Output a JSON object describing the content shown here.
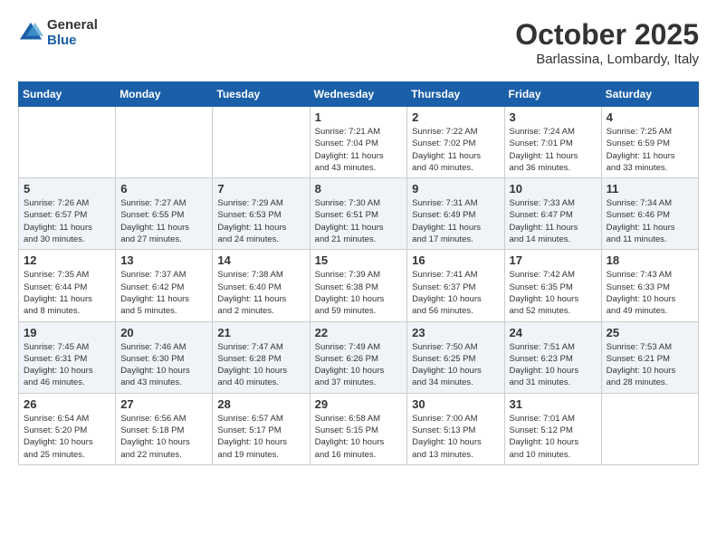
{
  "header": {
    "logo_general": "General",
    "logo_blue": "Blue",
    "month_title": "October 2025",
    "location": "Barlassina, Lombardy, Italy"
  },
  "calendar": {
    "days_of_week": [
      "Sunday",
      "Monday",
      "Tuesday",
      "Wednesday",
      "Thursday",
      "Friday",
      "Saturday"
    ],
    "weeks": [
      [
        {
          "day": "",
          "detail": ""
        },
        {
          "day": "",
          "detail": ""
        },
        {
          "day": "",
          "detail": ""
        },
        {
          "day": "1",
          "detail": "Sunrise: 7:21 AM\nSunset: 7:04 PM\nDaylight: 11 hours\nand 43 minutes."
        },
        {
          "day": "2",
          "detail": "Sunrise: 7:22 AM\nSunset: 7:02 PM\nDaylight: 11 hours\nand 40 minutes."
        },
        {
          "day": "3",
          "detail": "Sunrise: 7:24 AM\nSunset: 7:01 PM\nDaylight: 11 hours\nand 36 minutes."
        },
        {
          "day": "4",
          "detail": "Sunrise: 7:25 AM\nSunset: 6:59 PM\nDaylight: 11 hours\nand 33 minutes."
        }
      ],
      [
        {
          "day": "5",
          "detail": "Sunrise: 7:26 AM\nSunset: 6:57 PM\nDaylight: 11 hours\nand 30 minutes."
        },
        {
          "day": "6",
          "detail": "Sunrise: 7:27 AM\nSunset: 6:55 PM\nDaylight: 11 hours\nand 27 minutes."
        },
        {
          "day": "7",
          "detail": "Sunrise: 7:29 AM\nSunset: 6:53 PM\nDaylight: 11 hours\nand 24 minutes."
        },
        {
          "day": "8",
          "detail": "Sunrise: 7:30 AM\nSunset: 6:51 PM\nDaylight: 11 hours\nand 21 minutes."
        },
        {
          "day": "9",
          "detail": "Sunrise: 7:31 AM\nSunset: 6:49 PM\nDaylight: 11 hours\nand 17 minutes."
        },
        {
          "day": "10",
          "detail": "Sunrise: 7:33 AM\nSunset: 6:47 PM\nDaylight: 11 hours\nand 14 minutes."
        },
        {
          "day": "11",
          "detail": "Sunrise: 7:34 AM\nSunset: 6:46 PM\nDaylight: 11 hours\nand 11 minutes."
        }
      ],
      [
        {
          "day": "12",
          "detail": "Sunrise: 7:35 AM\nSunset: 6:44 PM\nDaylight: 11 hours\nand 8 minutes."
        },
        {
          "day": "13",
          "detail": "Sunrise: 7:37 AM\nSunset: 6:42 PM\nDaylight: 11 hours\nand 5 minutes."
        },
        {
          "day": "14",
          "detail": "Sunrise: 7:38 AM\nSunset: 6:40 PM\nDaylight: 11 hours\nand 2 minutes."
        },
        {
          "day": "15",
          "detail": "Sunrise: 7:39 AM\nSunset: 6:38 PM\nDaylight: 10 hours\nand 59 minutes."
        },
        {
          "day": "16",
          "detail": "Sunrise: 7:41 AM\nSunset: 6:37 PM\nDaylight: 10 hours\nand 56 minutes."
        },
        {
          "day": "17",
          "detail": "Sunrise: 7:42 AM\nSunset: 6:35 PM\nDaylight: 10 hours\nand 52 minutes."
        },
        {
          "day": "18",
          "detail": "Sunrise: 7:43 AM\nSunset: 6:33 PM\nDaylight: 10 hours\nand 49 minutes."
        }
      ],
      [
        {
          "day": "19",
          "detail": "Sunrise: 7:45 AM\nSunset: 6:31 PM\nDaylight: 10 hours\nand 46 minutes."
        },
        {
          "day": "20",
          "detail": "Sunrise: 7:46 AM\nSunset: 6:30 PM\nDaylight: 10 hours\nand 43 minutes."
        },
        {
          "day": "21",
          "detail": "Sunrise: 7:47 AM\nSunset: 6:28 PM\nDaylight: 10 hours\nand 40 minutes."
        },
        {
          "day": "22",
          "detail": "Sunrise: 7:49 AM\nSunset: 6:26 PM\nDaylight: 10 hours\nand 37 minutes."
        },
        {
          "day": "23",
          "detail": "Sunrise: 7:50 AM\nSunset: 6:25 PM\nDaylight: 10 hours\nand 34 minutes."
        },
        {
          "day": "24",
          "detail": "Sunrise: 7:51 AM\nSunset: 6:23 PM\nDaylight: 10 hours\nand 31 minutes."
        },
        {
          "day": "25",
          "detail": "Sunrise: 7:53 AM\nSunset: 6:21 PM\nDaylight: 10 hours\nand 28 minutes."
        }
      ],
      [
        {
          "day": "26",
          "detail": "Sunrise: 6:54 AM\nSunset: 5:20 PM\nDaylight: 10 hours\nand 25 minutes."
        },
        {
          "day": "27",
          "detail": "Sunrise: 6:56 AM\nSunset: 5:18 PM\nDaylight: 10 hours\nand 22 minutes."
        },
        {
          "day": "28",
          "detail": "Sunrise: 6:57 AM\nSunset: 5:17 PM\nDaylight: 10 hours\nand 19 minutes."
        },
        {
          "day": "29",
          "detail": "Sunrise: 6:58 AM\nSunset: 5:15 PM\nDaylight: 10 hours\nand 16 minutes."
        },
        {
          "day": "30",
          "detail": "Sunrise: 7:00 AM\nSunset: 5:13 PM\nDaylight: 10 hours\nand 13 minutes."
        },
        {
          "day": "31",
          "detail": "Sunrise: 7:01 AM\nSunset: 5:12 PM\nDaylight: 10 hours\nand 10 minutes."
        },
        {
          "day": "",
          "detail": ""
        }
      ]
    ]
  }
}
